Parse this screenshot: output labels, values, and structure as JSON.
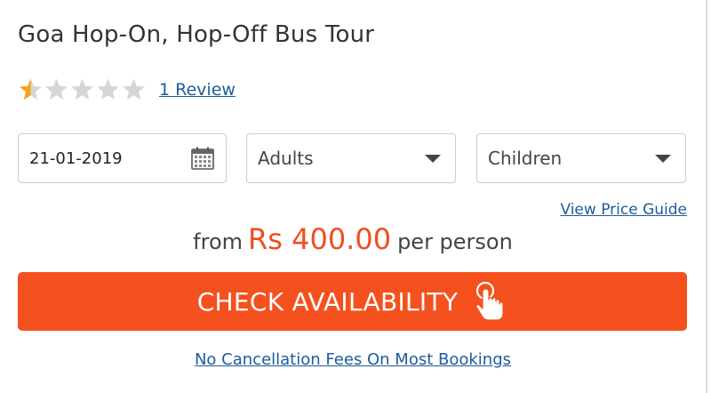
{
  "product": {
    "title": "Goa Hop-On, Hop-Off Bus Tour"
  },
  "rating": {
    "stars_filled": 1,
    "stars_total": 5,
    "review_link_label": "1 Review",
    "star_color": "#f7a21b",
    "empty_star_color": "#d6d6d6"
  },
  "booking_form": {
    "date_value": "21-01-2019",
    "date_icon": "calendar-icon",
    "adults_label": "Adults",
    "children_label": "Children",
    "dropdown_icon": "chevron-down-icon"
  },
  "pricing": {
    "price_guide_label": "View Price Guide",
    "prefix": "from",
    "amount": "Rs 400.00",
    "suffix": "per person",
    "amount_color": "#f04e1f"
  },
  "cta": {
    "label": "CHECK AVAILABILITY",
    "icon": "hand-pointer-icon",
    "color": "#f4511e"
  },
  "footer": {
    "no_cancellation_label": "No Cancellation Fees On Most Bookings",
    "link_color": "#1e5b9c"
  }
}
